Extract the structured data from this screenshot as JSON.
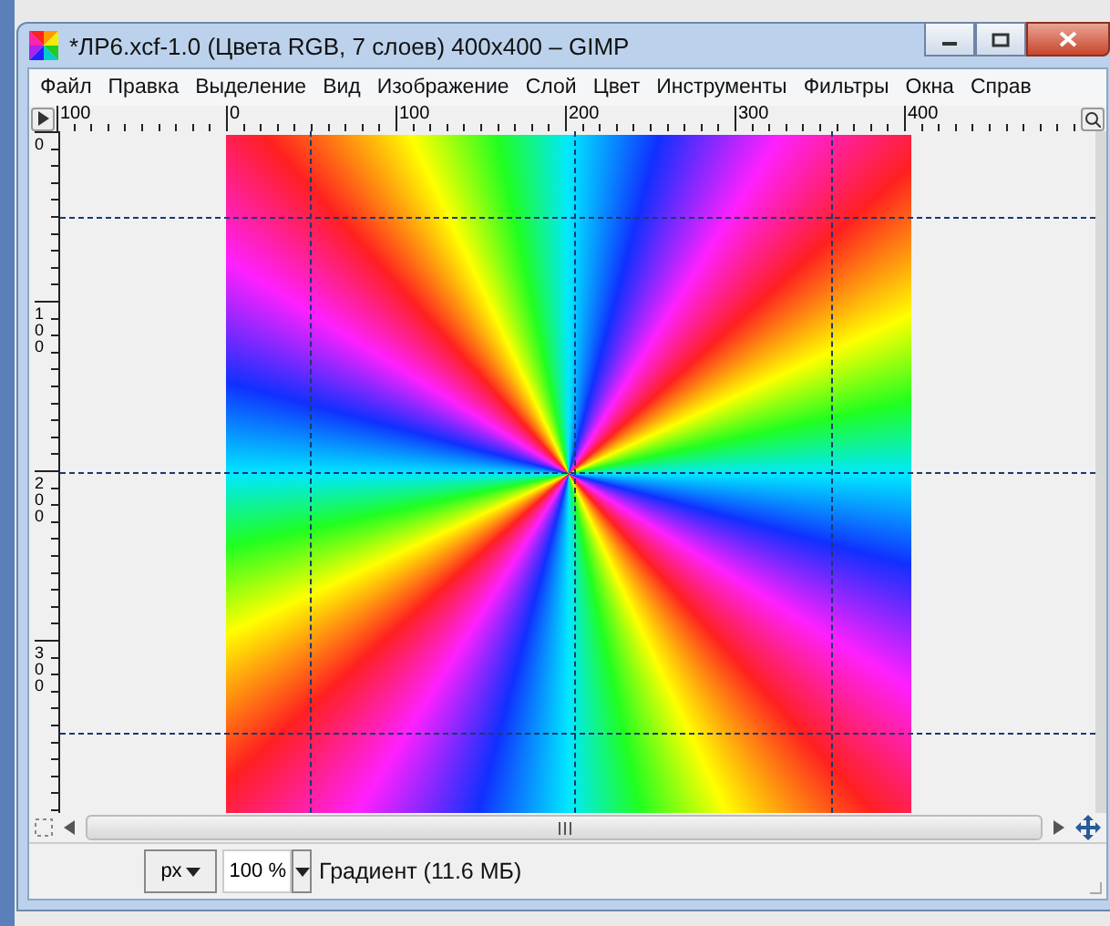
{
  "window": {
    "title": "*ЛР6.xcf-1.0 (Цвета RGB, 7 слоев) 400x400 – GIMP"
  },
  "menu": [
    {
      "label": "Файл"
    },
    {
      "label": "Правка"
    },
    {
      "label": "Выделение"
    },
    {
      "label": "Вид"
    },
    {
      "label": "Изображение"
    },
    {
      "label": "Слой"
    },
    {
      "label": "Цвет"
    },
    {
      "label": "Инструменты"
    },
    {
      "label": "Фильтры"
    },
    {
      "label": "Окна"
    },
    {
      "label": "Справ"
    }
  ],
  "rulers": {
    "top_labels": [
      "100",
      "0",
      "100",
      "200",
      "300",
      "400"
    ],
    "left_labels": [
      "0",
      "100",
      "200",
      "300"
    ]
  },
  "status_bar": {
    "unit": "px",
    "zoom": "100 %",
    "text": "Градиент (11.6 МБ)"
  }
}
